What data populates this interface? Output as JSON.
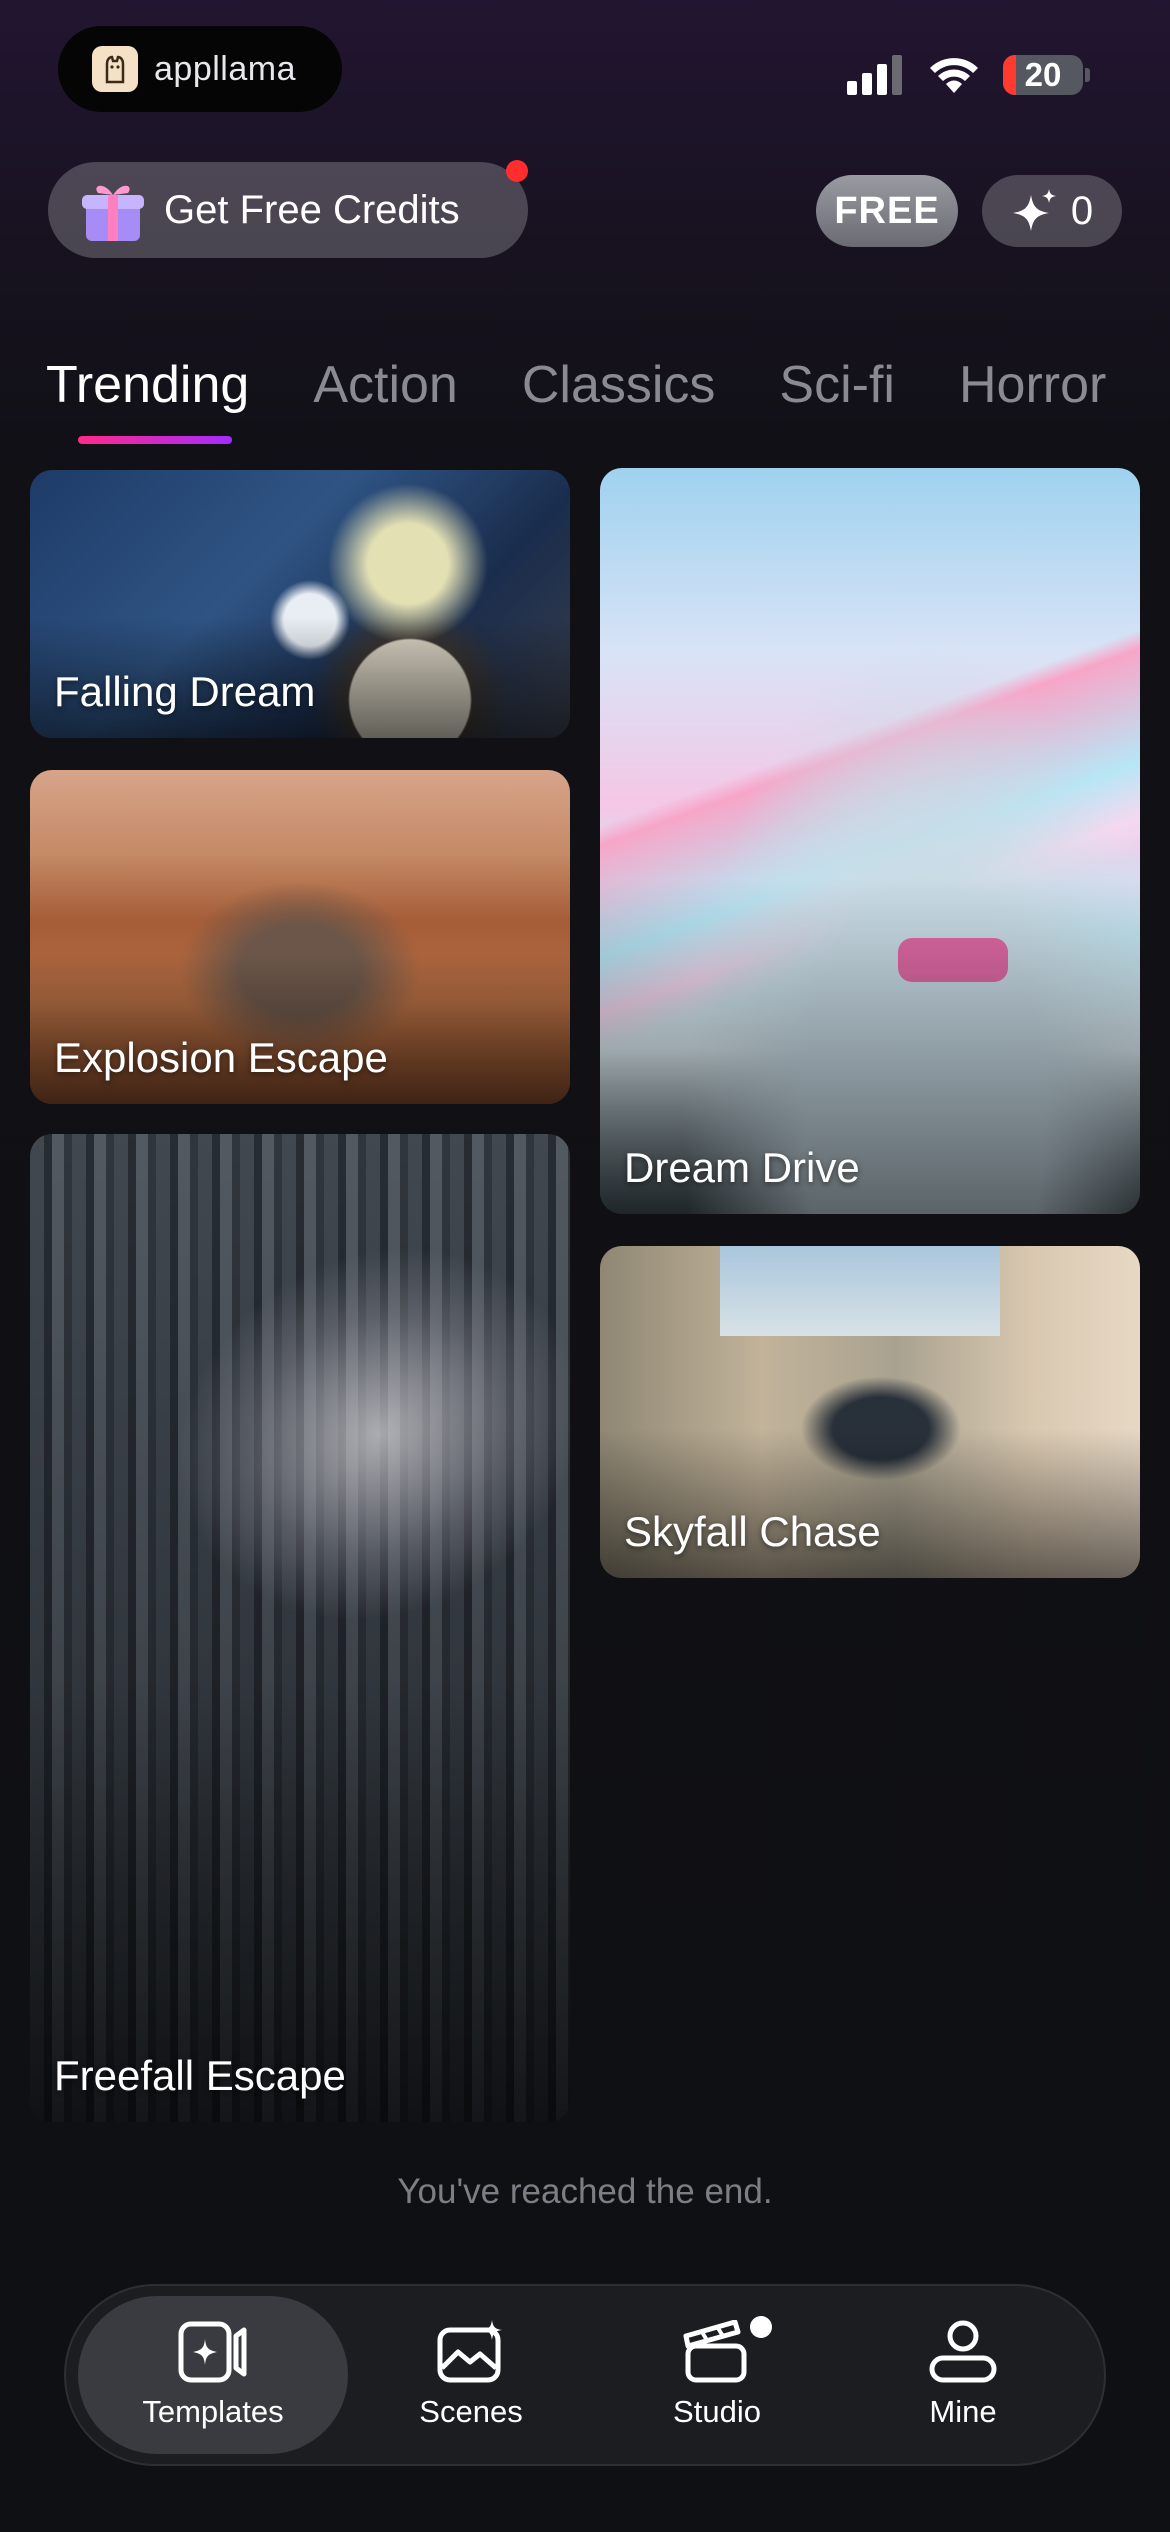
{
  "status": {
    "app_name": "appllama",
    "battery": "20"
  },
  "header": {
    "credits_label": "Get Free Credits",
    "free_badge": "FREE",
    "credits_count": "0"
  },
  "tabs": [
    {
      "label": "Trending",
      "active": true
    },
    {
      "label": "Action"
    },
    {
      "label": "Classics"
    },
    {
      "label": "Sci-fi"
    },
    {
      "label": "Horror"
    }
  ],
  "templates": [
    {
      "title": "Falling Dream"
    },
    {
      "title": "Explosion Escape"
    },
    {
      "title": "Freefall Escape"
    },
    {
      "title": "Dream Drive"
    },
    {
      "title": "Skyfall Chase"
    }
  ],
  "end_text": "You've reached the end.",
  "nav": [
    {
      "label": "Templates",
      "icon": "templates-icon",
      "active": true
    },
    {
      "label": "Scenes",
      "icon": "scenes-icon"
    },
    {
      "label": "Studio",
      "icon": "studio-icon",
      "badge": true
    },
    {
      "label": "Mine",
      "icon": "user-icon"
    }
  ],
  "colors": {
    "accent_start": "#ff2a8a",
    "accent_end": "#a52bff",
    "notification": "#ff2d2d"
  }
}
